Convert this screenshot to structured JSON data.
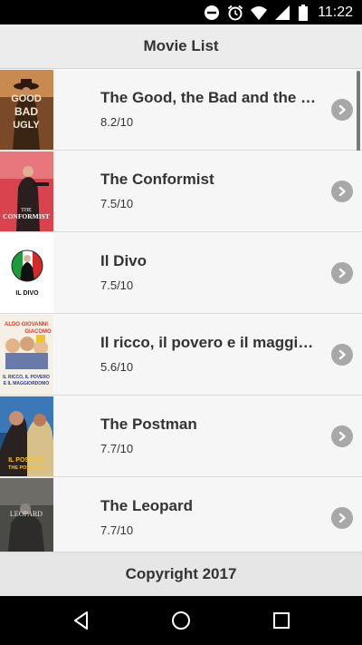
{
  "status_bar": {
    "time": "11:22",
    "icons": [
      "do-not-disturb-icon",
      "alarm-icon",
      "wifi-icon",
      "signal-icon",
      "battery-icon"
    ]
  },
  "header": {
    "title": "Movie List"
  },
  "movies": [
    {
      "title": "The Good, the Bad and the Ugly",
      "rating": "8.2/10",
      "poster_text": "GOOD BAD UGLY"
    },
    {
      "title": "The Conformist",
      "rating": "7.5/10",
      "poster_text": "THE CONFORMIST"
    },
    {
      "title": "Il Divo",
      "rating": "7.5/10",
      "poster_text": "IL DIVO"
    },
    {
      "title": "Il ricco, il povero e il maggiordomo",
      "rating": "5.6/10",
      "poster_text": "ALDO GIOVANNI GIACOMO"
    },
    {
      "title": "The Postman",
      "rating": "7.7/10",
      "poster_text": "IL POSTINO THE POSTMAN"
    },
    {
      "title": "The Leopard",
      "rating": "7.7/10",
      "poster_text": "LEOPARD"
    }
  ],
  "footer": {
    "text": "Copyright 2017"
  },
  "nav_bar": {
    "buttons": [
      "back-icon",
      "home-icon",
      "recents-icon"
    ]
  },
  "colors": {
    "status_bar_bg": "#000000",
    "header_bg": "#ececec",
    "list_bg": "#f6f6f6",
    "text": "#333333",
    "chevron_bg": "#a8a8a8",
    "footer_bg": "#e6e6e6"
  }
}
